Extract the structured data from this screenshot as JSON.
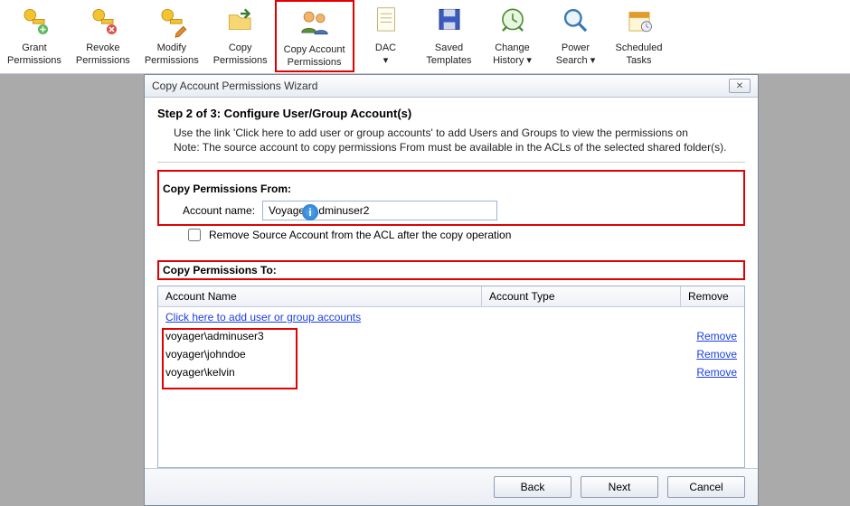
{
  "ribbon": [
    {
      "label1": "Grant",
      "label2": "Permissions",
      "icon": "key-plus"
    },
    {
      "label1": "Revoke",
      "label2": "Permissions",
      "icon": "key-x"
    },
    {
      "label1": "Modify",
      "label2": "Permissions",
      "icon": "key-edit"
    },
    {
      "label1": "Copy",
      "label2": "Permissions",
      "icon": "folder-copy"
    },
    {
      "label1": "Copy Account",
      "label2": "Permissions",
      "icon": "users-copy"
    },
    {
      "label1": "DAC",
      "label2": "▾",
      "icon": "page"
    },
    {
      "label1": "Saved",
      "label2": "Templates",
      "icon": "disk"
    },
    {
      "label1": "Change",
      "label2": "History ▾",
      "icon": "clock"
    },
    {
      "label1": "Power",
      "label2": "Search ▾",
      "icon": "magnify"
    },
    {
      "label1": "Scheduled",
      "label2": "Tasks",
      "icon": "calendar"
    }
  ],
  "wizard": {
    "title": "Copy Account Permissions Wizard",
    "step_heading": "Step 2 of 3: Configure User/Group Account(s)",
    "desc_line1": "Use the link 'Click here to add user or group accounts' to add Users and Groups to view the permissions on",
    "desc_line2": "Note: The source account to copy permissions From must be available in the ACLs of the selected shared folder(s).",
    "from_label": "Copy Permissions From:",
    "account_name_label": "Account name:",
    "account_name_value": "Voyager\\Adminuser2",
    "remove_source_chk": "Remove Source Account from the ACL after the copy operation",
    "to_label": "Copy Permissions To:",
    "col_name": "Account Name",
    "col_type": "Account Type",
    "col_remove": "Remove",
    "add_link": "Click here to add user or group accounts",
    "rows": [
      {
        "name": "voyager\\adminuser3"
      },
      {
        "name": "voyager\\johndoe"
      },
      {
        "name": "voyager\\kelvin"
      }
    ],
    "remove_link": "Remove",
    "btn_back": "Back",
    "btn_next": "Next",
    "btn_cancel": "Cancel"
  }
}
